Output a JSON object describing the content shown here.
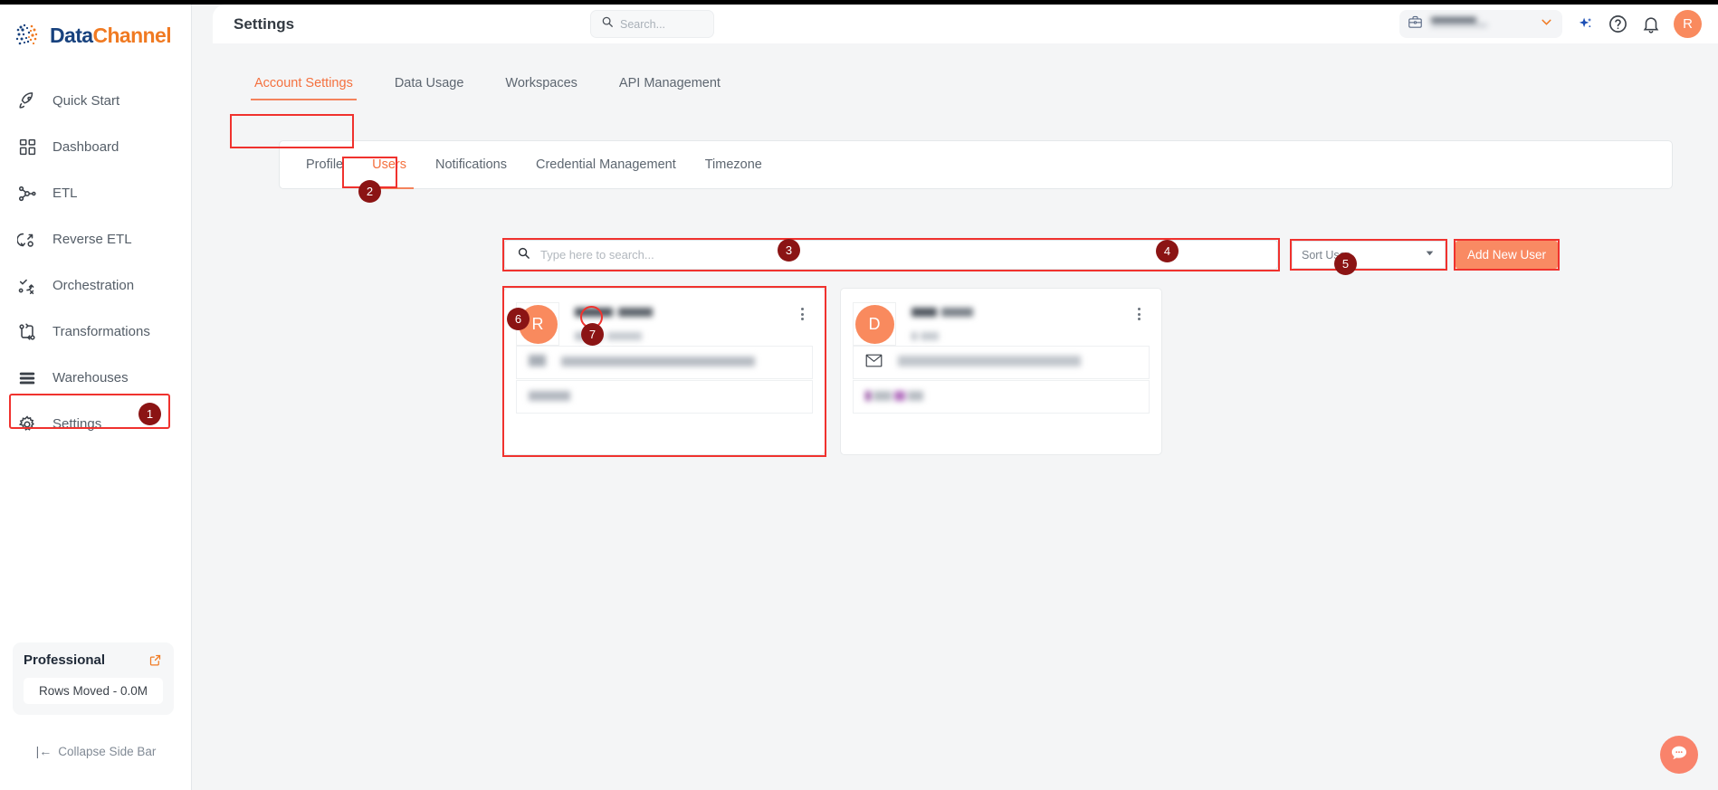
{
  "brand": {
    "name_part1": "Data",
    "name_part2": "Channel",
    "logo_icon": "datachannel-logo-icon",
    "color_blue": "#18427e",
    "color_orange": "#f07a22"
  },
  "sidebar": {
    "items": [
      {
        "label": "Quick Start",
        "icon": "rocket-icon"
      },
      {
        "label": "Dashboard",
        "icon": "grid-icon"
      },
      {
        "label": "ETL",
        "icon": "etl-nodes-icon"
      },
      {
        "label": "Reverse ETL",
        "icon": "reverse-etl-icon"
      },
      {
        "label": "Orchestration",
        "icon": "orchestration-icon"
      },
      {
        "label": "Transformations",
        "icon": "transformations-icon"
      },
      {
        "label": "Warehouses",
        "icon": "warehouse-stack-icon"
      },
      {
        "label": "Settings",
        "icon": "gear-icon"
      }
    ],
    "plan": {
      "name": "Professional",
      "external_link_icon": "external-link-icon",
      "rows_moved": "Rows Moved - 0.0M"
    },
    "collapse": {
      "icon": "collapse-left-icon",
      "label": "Collapse Side Bar"
    }
  },
  "header": {
    "title": "Settings",
    "search": {
      "placeholder": "Search...",
      "value": "",
      "icon": "search-icon"
    },
    "workspace": {
      "icon": "briefcase-icon",
      "value_redacted": true,
      "chevron": "chevron-down-icon"
    },
    "actions": [
      {
        "name": "ai-sparkle-icon"
      },
      {
        "name": "help-circle-icon"
      },
      {
        "name": "bell-icon"
      }
    ],
    "avatar": {
      "initial": "R",
      "color": "#f98a5e"
    }
  },
  "tabs": {
    "items": [
      {
        "label": "Account Settings",
        "active": true
      },
      {
        "label": "Data Usage",
        "active": false
      },
      {
        "label": "Workspaces",
        "active": false
      },
      {
        "label": "API Management",
        "active": false
      }
    ]
  },
  "subtabs": {
    "items": [
      {
        "label": "Profile",
        "active": false
      },
      {
        "label": "Users",
        "active": true
      },
      {
        "label": "Notifications",
        "active": false
      },
      {
        "label": "Credential Management",
        "active": false
      },
      {
        "label": "Timezone",
        "active": false
      }
    ]
  },
  "toolbar": {
    "search": {
      "placeholder": "Type here to search...",
      "value": "",
      "icon": "search-icon"
    },
    "sort": {
      "label": "Sort User",
      "caret": "caret-down-icon"
    },
    "add_user_label": "Add New User"
  },
  "users": [
    {
      "avatar_initial": "R",
      "name_redacted": true,
      "role_redacted": true,
      "row1_icon": "redacted-icon",
      "row1_redacted": true,
      "row2_redacted": true,
      "kebab": "more-vertical-icon"
    },
    {
      "avatar_initial": "D",
      "name_redacted": true,
      "role_redacted": true,
      "row1_icon": "envelope-icon",
      "row1_redacted": true,
      "row2_redacted": true,
      "kebab": "more-vertical-icon"
    }
  ],
  "annotations": {
    "accent_color": "#f0322e",
    "badge_color": "#8b1414",
    "badges": [
      {
        "n": "1",
        "target": "sidebar-item-settings"
      },
      {
        "n": "2",
        "target": "subtab-users"
      },
      {
        "n": "3",
        "target": "user-search-input"
      },
      {
        "n": "4",
        "target": "sort-user-select"
      },
      {
        "n": "5",
        "target": "add-new-user-button"
      },
      {
        "n": "6",
        "target": "user-card-1"
      },
      {
        "n": "7",
        "target": "user-card-1-kebab"
      }
    ]
  },
  "chat_widget": {
    "icon": "chat-bubble-icon",
    "color": "#f9836b"
  }
}
